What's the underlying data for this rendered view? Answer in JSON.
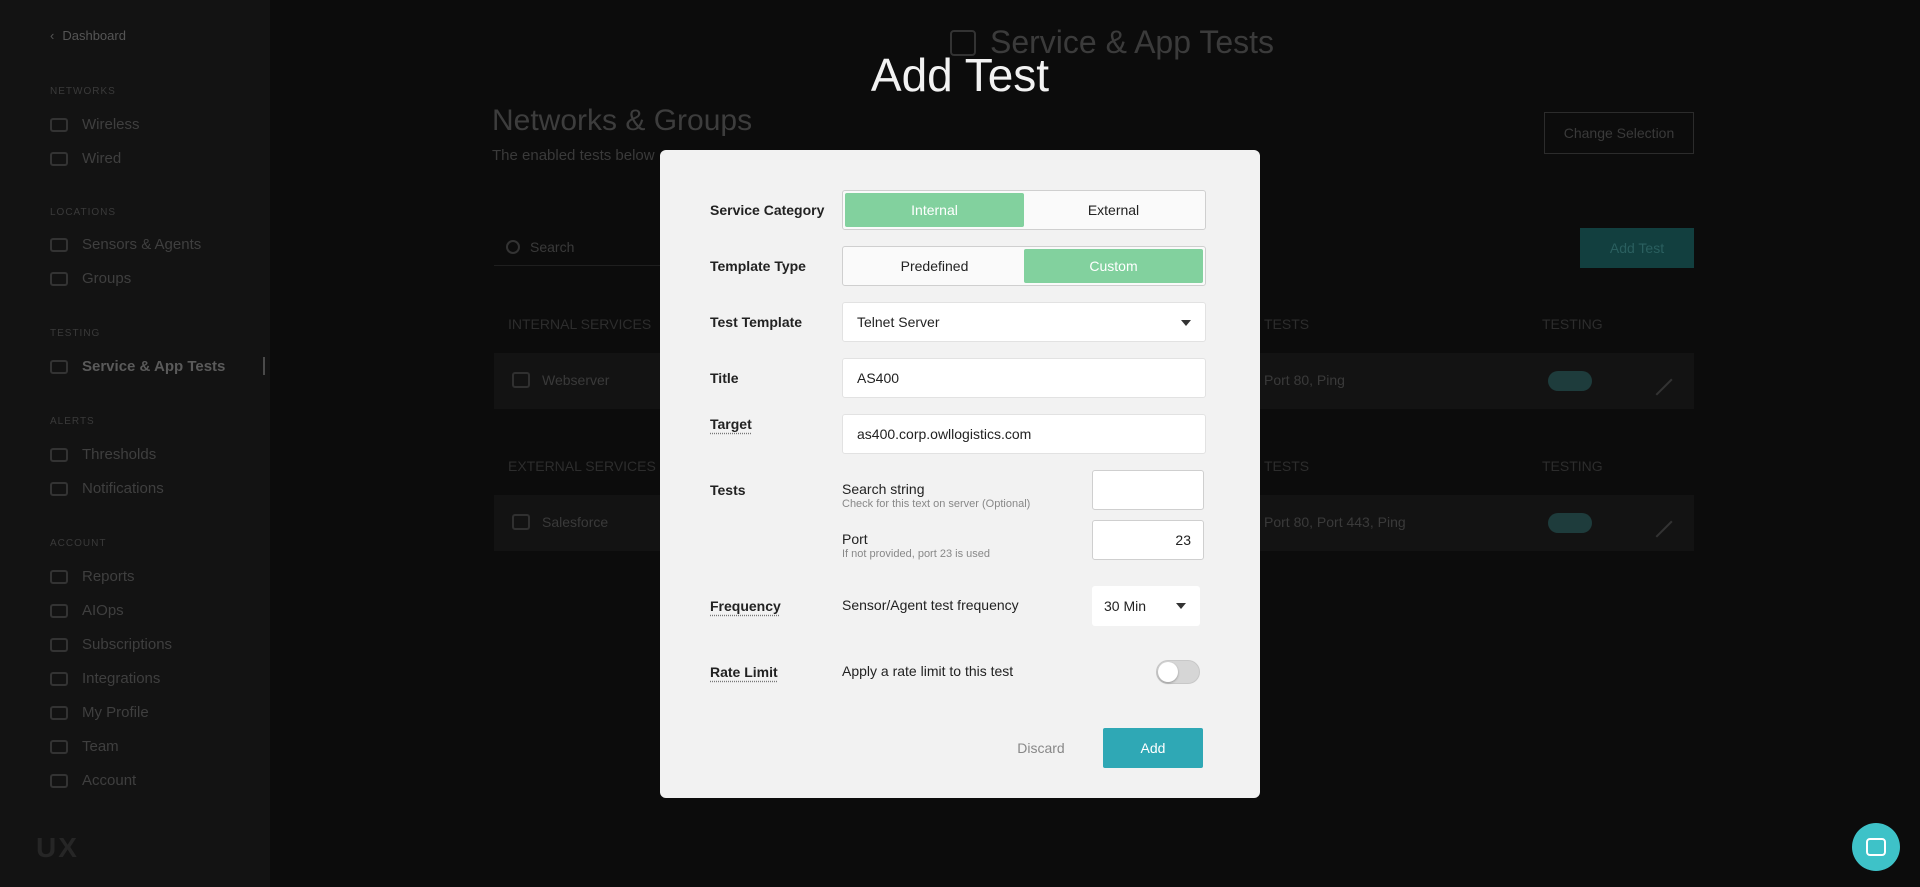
{
  "sidebar": {
    "back_label": "Dashboard",
    "sections": [
      {
        "title": "NETWORKS",
        "items": [
          "Wireless",
          "Wired"
        ]
      },
      {
        "title": "LOCATIONS",
        "items": [
          "Sensors & Agents",
          "Groups"
        ]
      },
      {
        "title": "TESTING",
        "items": [
          "Service & App Tests"
        ]
      },
      {
        "title": "ALERTS",
        "items": [
          "Thresholds",
          "Notifications"
        ]
      },
      {
        "title": "ACCOUNT",
        "items": [
          "Reports",
          "AIOps",
          "Subscriptions",
          "Integrations",
          "My Profile",
          "Team",
          "Account"
        ]
      }
    ],
    "logo": "UX"
  },
  "background": {
    "header_title": "Service & App Tests",
    "page_title": "Networks & Groups",
    "page_subtitle": "The enabled tests below",
    "change_selection": "Change Selection",
    "search_placeholder": "Search",
    "add_test_button": "Add Test",
    "internal_section": "INTERNAL SERVICES",
    "external_section": "EXTERNAL SERVICES",
    "col_tests": "TESTS",
    "col_testing": "TESTING",
    "rows": [
      {
        "name": "Webserver",
        "tests": "Port 80, Ping"
      },
      {
        "name": "Salesforce",
        "tests": "Port 80, Port 443, Ping"
      }
    ]
  },
  "modal": {
    "title": "Add Test",
    "service_category": {
      "label": "Service Category",
      "options": [
        "Internal",
        "External"
      ],
      "selected": "Internal"
    },
    "template_type": {
      "label": "Template Type",
      "options": [
        "Predefined",
        "Custom"
      ],
      "selected": "Custom"
    },
    "test_template": {
      "label": "Test Template",
      "value": "Telnet Server"
    },
    "title_field": {
      "label": "Title",
      "value": "AS400"
    },
    "target": {
      "label": "Target",
      "value": "as400.corp.owllogistics.com"
    },
    "tests": {
      "label": "Tests",
      "search_string": {
        "label": "Search string",
        "hint": "Check for this text on server (Optional)",
        "value": ""
      },
      "port": {
        "label": "Port",
        "hint": "If not provided, port 23 is used",
        "value": "23"
      }
    },
    "frequency": {
      "label": "Frequency",
      "description": "Sensor/Agent test frequency",
      "value": "30 Min"
    },
    "rate_limit": {
      "label": "Rate Limit",
      "description": "Apply a rate limit to this test",
      "enabled": false
    },
    "discard_label": "Discard",
    "add_label": "Add"
  },
  "colors": {
    "accent_green": "#82d19e",
    "accent_teal": "#2fa8b5",
    "chat": "#3ec2c8"
  }
}
